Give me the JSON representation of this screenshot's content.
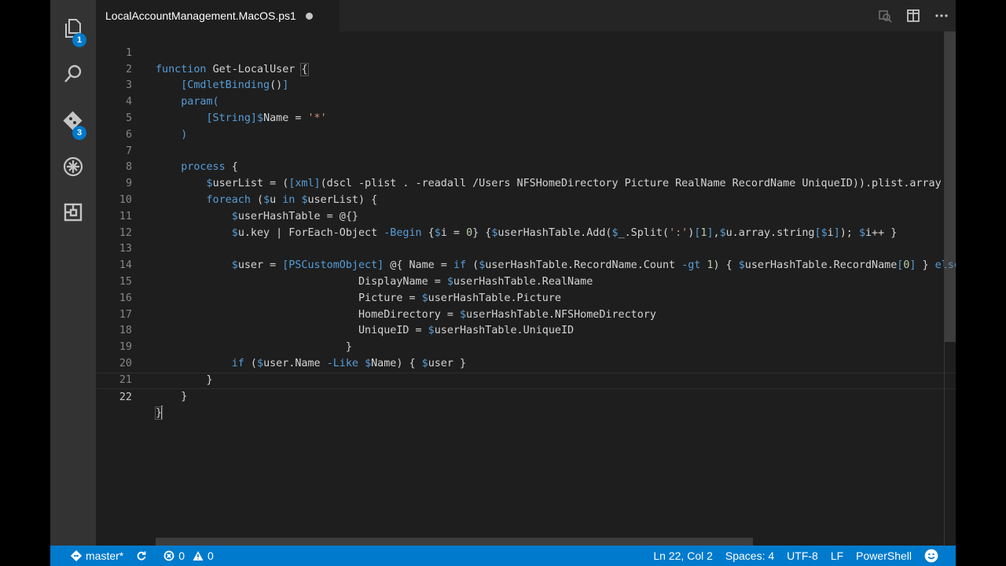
{
  "activity_bar": {
    "explorer_badge": "1",
    "scm_badge": "3"
  },
  "tab": {
    "title": "LocalAccountManagement.MacOS.ps1"
  },
  "editor": {
    "line_numbers": [
      "1",
      "2",
      "3",
      "4",
      "5",
      "6",
      "7",
      "8",
      "9",
      "10",
      "11",
      "12",
      "13",
      "14",
      "15",
      "16",
      "17",
      "18",
      "19",
      "20",
      "21",
      "22"
    ],
    "active_line": 22
  },
  "status_bar": {
    "branch": "master*",
    "errors": "0",
    "warnings": "0",
    "position": "Ln 22, Col 2",
    "spaces": "Spaces: 4",
    "encoding": "UTF-8",
    "eol": "LF",
    "language": "PowerShell"
  },
  "colors": {
    "status_bar": "#007acc",
    "editor_bg": "#1e1e1e",
    "activity_bar": "#333333",
    "keyword": "#569cd6",
    "variable": "#9cdcfe",
    "string": "#ce9178",
    "number": "#b5cea8",
    "type": "#4ec9b0"
  }
}
